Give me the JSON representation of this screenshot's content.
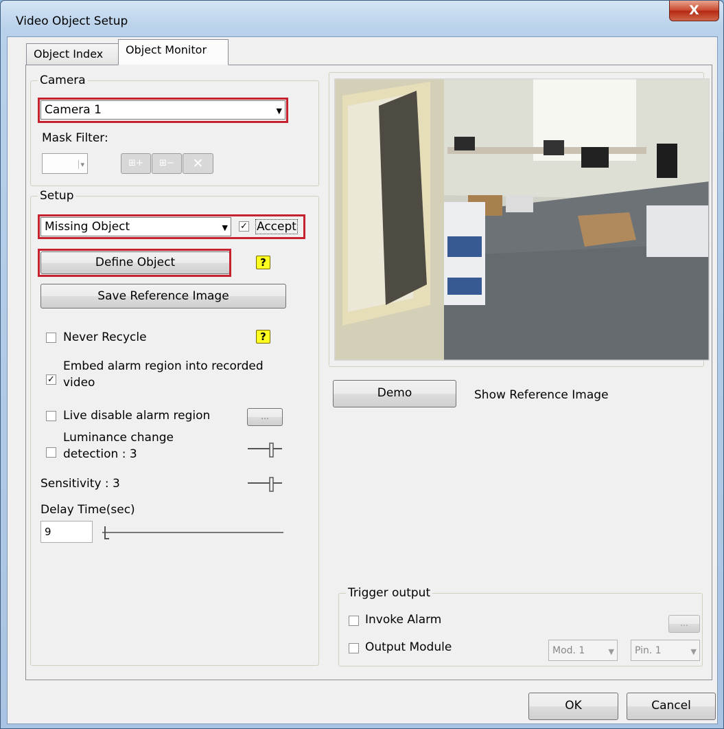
{
  "window": {
    "title": "Video Object Setup",
    "close_label": "X"
  },
  "tabs": [
    {
      "label": "Object Index"
    },
    {
      "label": "Object Monitor"
    }
  ],
  "camera": {
    "legend": "Camera",
    "selected": "Camera 1",
    "mask_filter_label": "Mask Filter:"
  },
  "setup": {
    "legend": "Setup",
    "object_type": "Missing Object",
    "accept_label": "Accept",
    "accept_checked": true,
    "define_object_label": "Define Object",
    "save_reference_label": "Save Reference Image",
    "never_recycle_label": "Never Recycle",
    "embed_label_line1": "Embed alarm region into recorded",
    "embed_label_line2": "video",
    "live_disable_label": "Live disable alarm region",
    "luminance_label_line1": "Luminance change",
    "luminance_label_line2": "detection : 3",
    "sensitivity_label": "Sensitivity : 3",
    "delay_label": "Delay Time(sec)",
    "delay_value": "9",
    "ellipsis": "...",
    "help_glyph": "?"
  },
  "preview": {
    "demo_label": "Demo",
    "show_reference_label": "Show Reference Image"
  },
  "trigger": {
    "legend": "Trigger output",
    "invoke_alarm_label": "Invoke Alarm",
    "output_module_label": "Output Module",
    "module_value": "Mod. 1",
    "pin_value": "Pin. 1",
    "ellipsis": "..."
  },
  "footer": {
    "ok_label": "OK",
    "cancel_label": "Cancel"
  }
}
